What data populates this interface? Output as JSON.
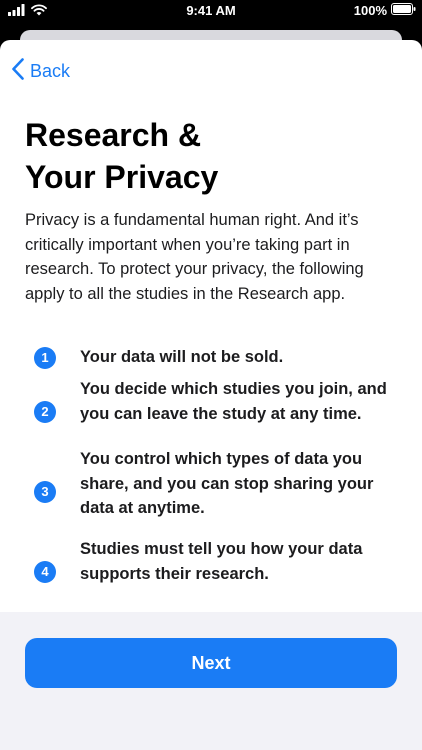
{
  "status_bar": {
    "time": "9:41 AM",
    "battery": "100%",
    "icons": [
      "signal-icon",
      "wifi-icon",
      "battery-icon"
    ]
  },
  "nav": {
    "back_label": "Back",
    "back_icon": "chevron-left-icon"
  },
  "header": {
    "title_line1": "Research &",
    "title_line2": "Your Privacy"
  },
  "intro": "Privacy is a fundamental human right. And it’s critically important when you’re taking part in research. To protect your privacy, the following apply to all the studies in the Research app.",
  "principles": [
    {
      "number": "1",
      "text": "Your data will not be sold."
    },
    {
      "number": "2",
      "text": "You decide which studies you join, and you can leave the study at any time."
    },
    {
      "number": "3",
      "text": "You control which types of data you share, and you can stop sharing your data at anytime."
    },
    {
      "number": "4",
      "text": "Studies must tell you how your data supports their research."
    }
  ],
  "footer": {
    "next_label": "Next"
  },
  "colors": {
    "accent": "#1a7cf5",
    "sheet_background": "#ffffff",
    "footer_background": "#f2f2f7",
    "status_bar_background": "#000000"
  }
}
